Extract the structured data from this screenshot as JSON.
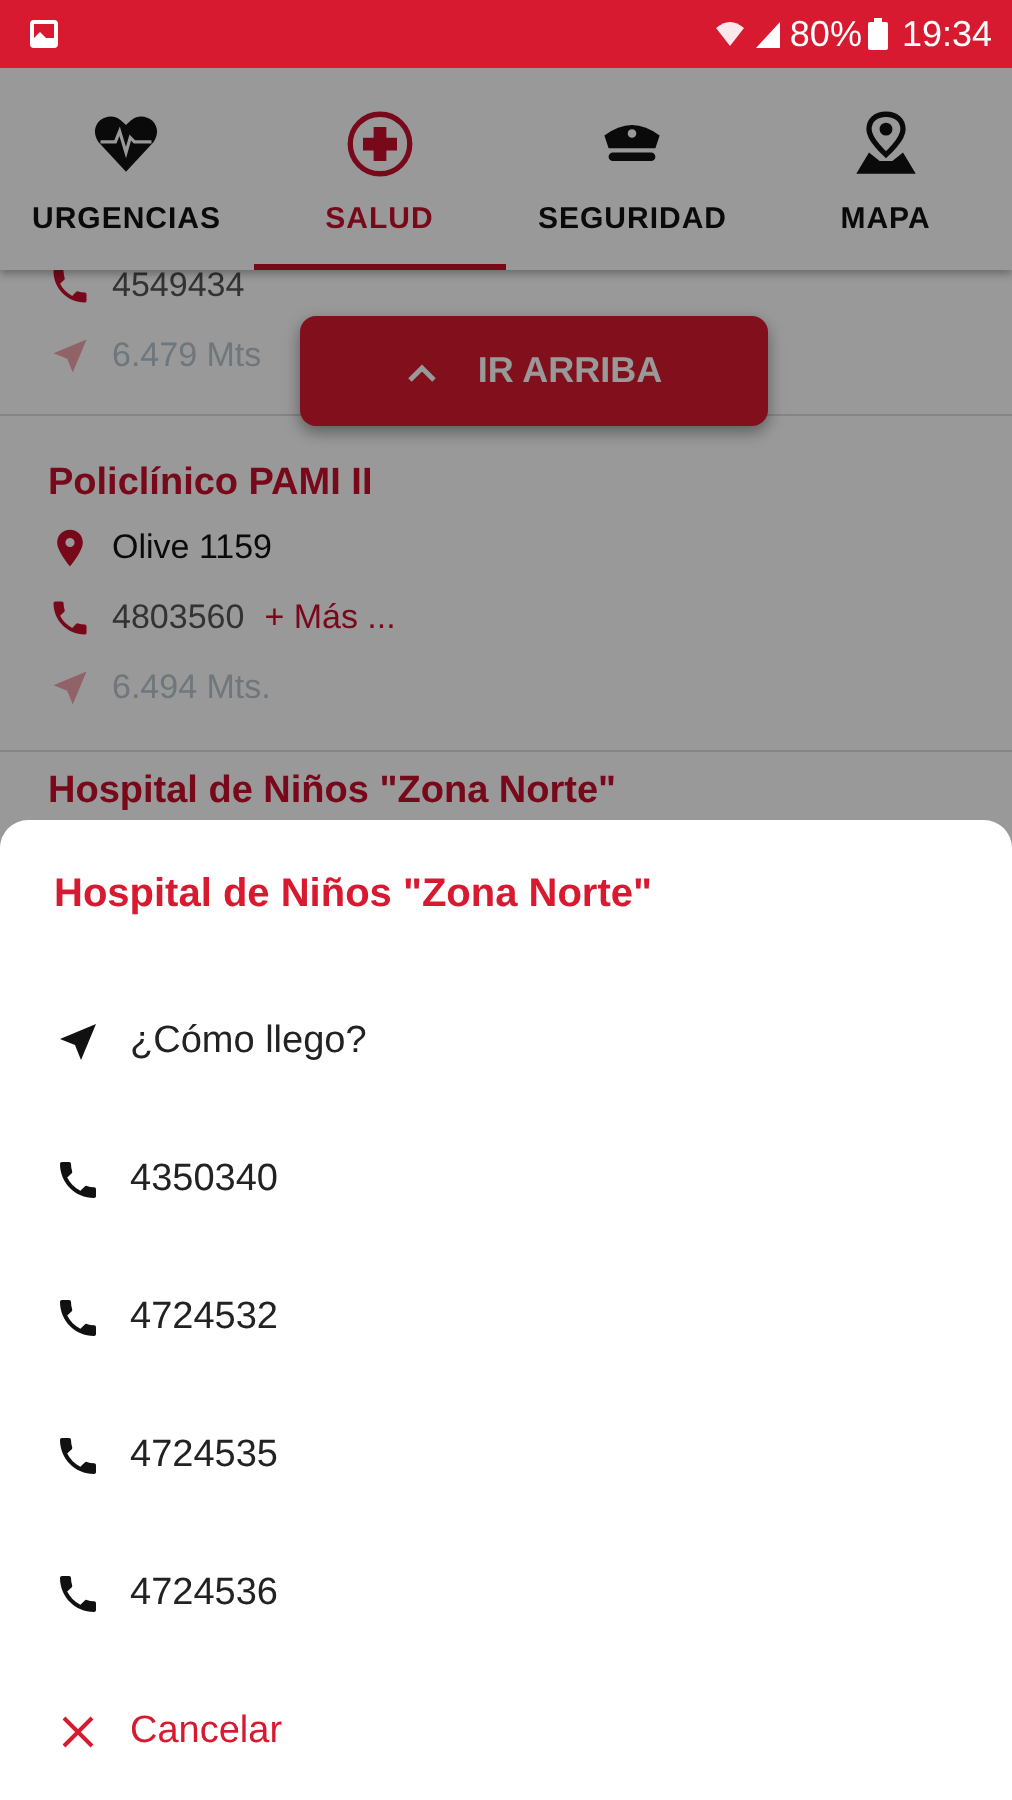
{
  "status_bar": {
    "battery": "80%",
    "time": "19:34"
  },
  "tabs": [
    {
      "label": "URGENCIAS",
      "kind": "heart",
      "selected": false
    },
    {
      "label": "SALUD",
      "kind": "cross",
      "selected": true
    },
    {
      "label": "SEGURIDAD",
      "kind": "cap",
      "selected": false
    },
    {
      "label": "MAPA",
      "kind": "map",
      "selected": false
    }
  ],
  "list": {
    "items": [
      {
        "phone": "4549434",
        "distance": "6.479 Mts"
      },
      {
        "name": "Policlínico PAMI II",
        "address": "Olive 1159",
        "phone": "4803560",
        "more": "+ Más ...",
        "distance": "6.494 Mts."
      },
      {
        "name": "Hospital de Niños \"Zona Norte\""
      }
    ]
  },
  "scroll_top_button": {
    "label": "IR ARRIBA"
  },
  "sheet": {
    "title": "Hospital de Niños \"Zona Norte\"",
    "actions": [
      {
        "kind": "directions",
        "label": "¿Cómo llego?"
      },
      {
        "kind": "phone",
        "label": "4350340"
      },
      {
        "kind": "phone",
        "label": "4724532"
      },
      {
        "kind": "phone",
        "label": "4724535"
      },
      {
        "kind": "phone",
        "label": "4724536"
      },
      {
        "kind": "cancel",
        "label": "Cancelar"
      }
    ]
  }
}
